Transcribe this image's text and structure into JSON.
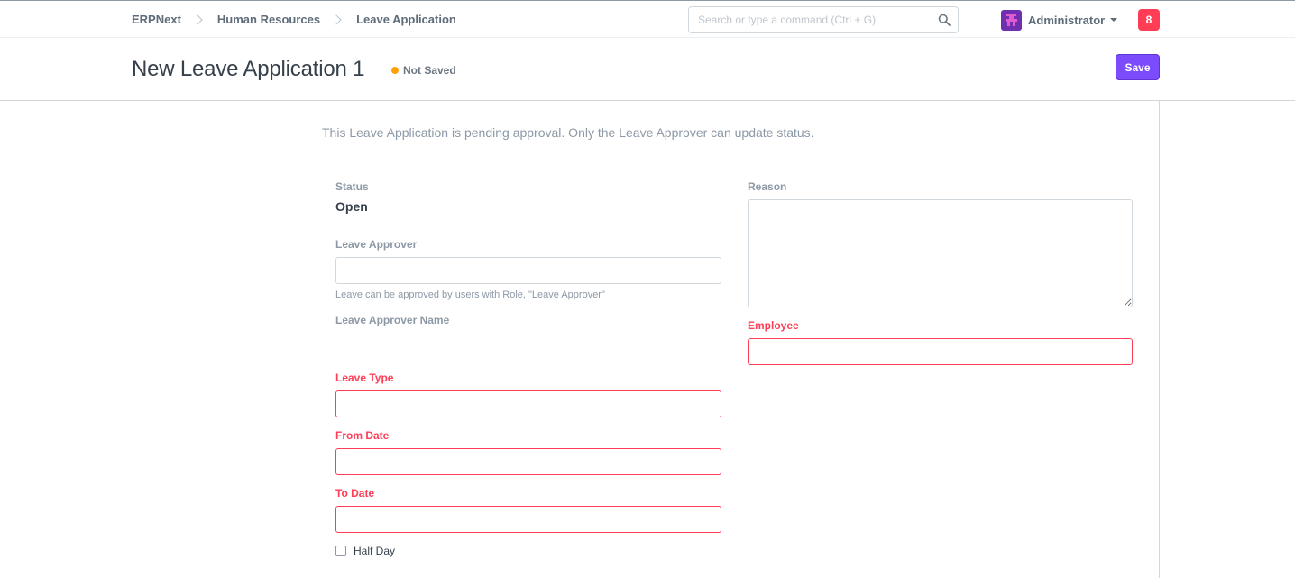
{
  "navbar": {
    "breadcrumbs": [
      "ERPNext",
      "Human Resources",
      "Leave Application"
    ],
    "search_placeholder": "Search or type a command (Ctrl + G)",
    "user_name": "Administrator",
    "notification_count": "8"
  },
  "header": {
    "title": "New Leave Application 1",
    "status_indicator": "Not Saved",
    "save_label": "Save"
  },
  "form": {
    "pending_message": "This Leave Application is pending approval. Only the Leave Approver can update status.",
    "status_label": "Status",
    "status_value": "Open",
    "leave_approver_label": "Leave Approver",
    "leave_approver_value": "",
    "leave_approver_help": "Leave can be approved by users with Role, \"Leave Approver\"",
    "leave_approver_name_label": "Leave Approver Name",
    "leave_type_label": "Leave Type",
    "leave_type_value": "",
    "from_date_label": "From Date",
    "from_date_value": "",
    "to_date_label": "To Date",
    "to_date_value": "",
    "half_day_label": "Half Day",
    "reason_label": "Reason",
    "reason_value": "",
    "employee_label": "Employee",
    "employee_value": ""
  },
  "colors": {
    "primary": "#7b4bfc",
    "required": "#ff3d55",
    "indicator_orange": "#ffa00a"
  }
}
